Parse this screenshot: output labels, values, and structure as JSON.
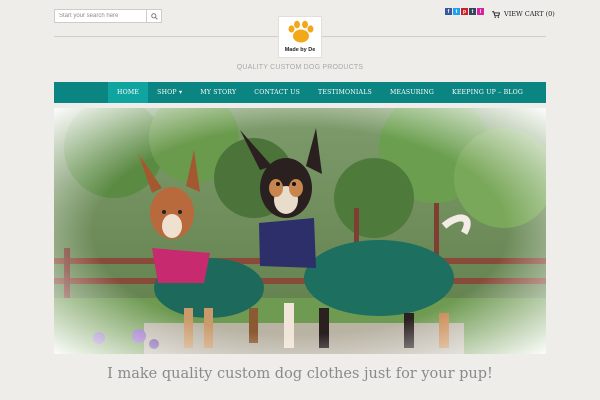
{
  "search": {
    "placeholder": "Start your search here",
    "icon": "search-icon"
  },
  "logo": {
    "text": "Made by De",
    "icon": "paw-icon"
  },
  "tagline": "QUALITY CUSTOM DOG PRODUCTS",
  "social": [
    {
      "name": "facebook-icon",
      "glyph": "f",
      "color": "#3b5998"
    },
    {
      "name": "twitter-icon",
      "glyph": "t",
      "color": "#1da1f2"
    },
    {
      "name": "pinterest-icon",
      "glyph": "p",
      "color": "#cb2027"
    },
    {
      "name": "tumblr-icon",
      "glyph": "t",
      "color": "#35465c"
    },
    {
      "name": "instagram-icon",
      "glyph": "i",
      "color": "#d6249f"
    }
  ],
  "cart": {
    "label": "VIEW CART (0)",
    "icon": "cart-icon"
  },
  "nav": {
    "items": [
      {
        "label": "HOME",
        "active": true
      },
      {
        "label": "SHOP ▾"
      },
      {
        "label": "MY STORY"
      },
      {
        "label": "CONTACT US"
      },
      {
        "label": "TESTIMONIALS"
      },
      {
        "label": "MEASURING"
      },
      {
        "label": "KEEPING UP – BLOG"
      }
    ],
    "bg": "#0a8582",
    "active_bg": "#10a4a0"
  },
  "hero": {
    "alt": "two dogs wearing green coats"
  },
  "caption": "I make quality custom dog clothes just for your pup!"
}
